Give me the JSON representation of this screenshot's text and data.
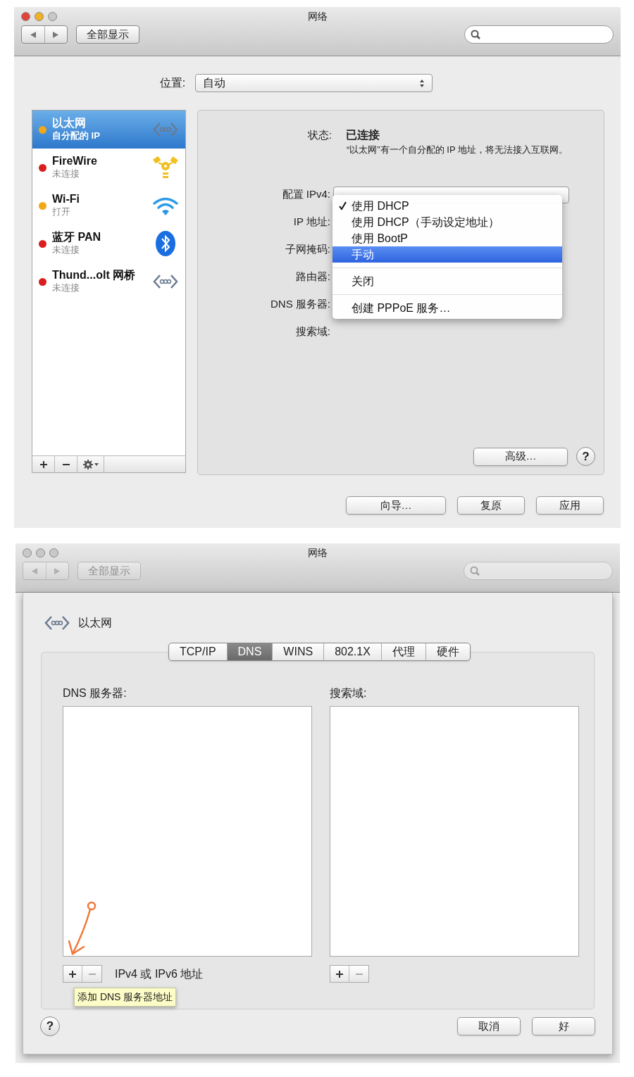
{
  "window_1": {
    "title": "网络",
    "toolbar": {
      "disabled": false,
      "show_all": "全部显示"
    },
    "location": {
      "label": "位置:",
      "value": "自动"
    },
    "services": [
      {
        "name": "以太网",
        "status": "自分配的 IP",
        "color": "#f0a818",
        "kind": "ethernet",
        "selected": true
      },
      {
        "name": "FireWire",
        "status": "未连接",
        "color": "#d81e1e",
        "kind": "firewire",
        "selected": false
      },
      {
        "name": "Wi-Fi",
        "status": "打开",
        "color": "#f0a818",
        "kind": "wifi",
        "selected": false
      },
      {
        "name": "蓝牙 PAN",
        "status": "未连接",
        "color": "#d81e1e",
        "kind": "bluetooth",
        "selected": false
      },
      {
        "name": "Thund...olt 网桥",
        "status": "未连接",
        "color": "#d81e1e",
        "kind": "ethernet",
        "selected": false
      }
    ],
    "detail": {
      "status_label": "状态:",
      "status_value": "已连接",
      "status_note": "“以太网”有一个自分配的 IP 地址，将无法接入互联网。",
      "field_labels": [
        "配置 IPv4:",
        "IP 地址:",
        "子网掩码:",
        "路由器:",
        "DNS 服务器:",
        "搜索域:"
      ],
      "menu_groups": [
        [
          {
            "label": "使用 DHCP",
            "checked": true,
            "selected": false
          },
          {
            "label": "使用 DHCP（手动设定地址）",
            "checked": false,
            "selected": false
          },
          {
            "label": "使用 BootP",
            "checked": false,
            "selected": false
          },
          {
            "label": "手动",
            "checked": false,
            "selected": true
          }
        ],
        [
          {
            "label": "关闭",
            "checked": false,
            "selected": false
          }
        ],
        [
          {
            "label": "创建 PPPoE 服务…",
            "checked": false,
            "selected": false
          }
        ]
      ],
      "advanced_button": "高级…",
      "help": "?"
    },
    "buttons": [
      "向导…",
      "复原",
      "应用"
    ]
  },
  "window_2": {
    "title": "网络",
    "toolbar": {
      "disabled": true,
      "show_all": "全部显示"
    },
    "service": {
      "name": "以太网",
      "kind": "ethernet"
    },
    "tabs": [
      {
        "label": "TCP/IP",
        "selected": false
      },
      {
        "label": "DNS",
        "selected": true
      },
      {
        "label": "WINS",
        "selected": false
      },
      {
        "label": "802.1X",
        "selected": false
      },
      {
        "label": "代理",
        "selected": false
      },
      {
        "label": "硬件",
        "selected": false
      }
    ],
    "dns_servers": {
      "label": "DNS 服务器:",
      "hint": "IPv4 或 IPv6 地址",
      "tooltip": "添加 DNS 服务器地址"
    },
    "search_domains": {
      "label": "搜索域:"
    },
    "help": "?",
    "buttons": [
      "取消",
      "好"
    ]
  }
}
